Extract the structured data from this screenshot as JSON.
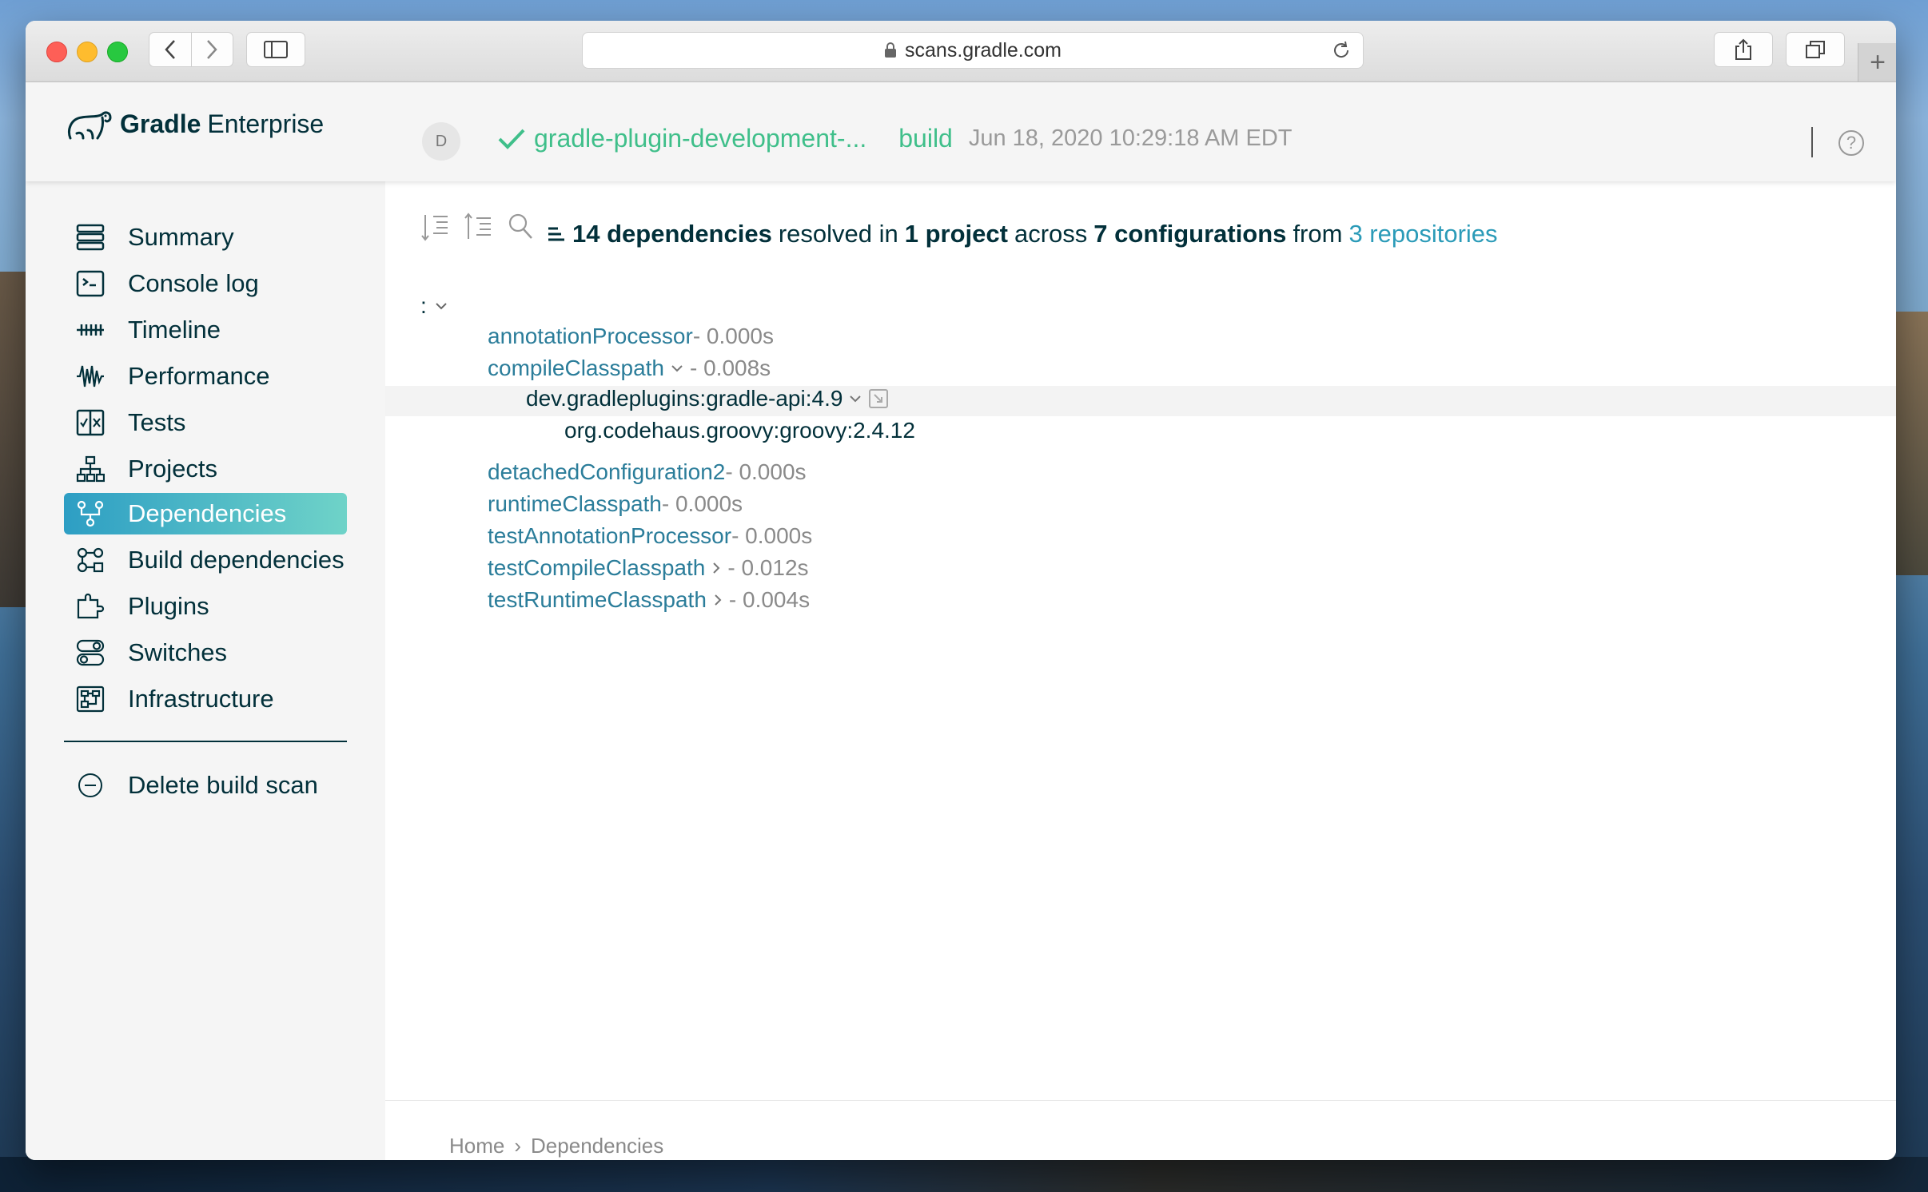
{
  "browser": {
    "url": "scans.gradle.com"
  },
  "app": {
    "logo_bold": "Gradle",
    "logo_light": "Enterprise",
    "avatar_initial": "D",
    "project": "gradle-plugin-development-...",
    "task": "build",
    "timestamp": "Jun 18, 2020 10:29:18 AM EDT",
    "status_color": "#3fbf8a"
  },
  "sidebar": {
    "items": [
      {
        "label": "Summary",
        "icon": "summary-icon"
      },
      {
        "label": "Console log",
        "icon": "console-icon"
      },
      {
        "label": "Timeline",
        "icon": "timeline-icon"
      },
      {
        "label": "Performance",
        "icon": "performance-icon"
      },
      {
        "label": "Tests",
        "icon": "tests-icon"
      },
      {
        "label": "Projects",
        "icon": "projects-icon"
      },
      {
        "label": "Dependencies",
        "icon": "dependencies-icon",
        "active": true
      },
      {
        "label": "Build dependencies",
        "icon": "build-dependencies-icon"
      },
      {
        "label": "Plugins",
        "icon": "plugins-icon"
      },
      {
        "label": "Switches",
        "icon": "switches-icon"
      },
      {
        "label": "Infrastructure",
        "icon": "infrastructure-icon"
      }
    ],
    "delete_label": "Delete build scan"
  },
  "summary": {
    "count": "14 dependencies",
    "resolved_in": "resolved in",
    "projects": "1 project",
    "across": "across",
    "configurations": "7 configurations",
    "from": "from",
    "repositories": "3 repositories"
  },
  "tree": {
    "root": ":",
    "configs": [
      {
        "name": "annotationProcessor",
        "duration": "- 0.000s"
      },
      {
        "name": "compileClasspath",
        "duration": "- 0.008s",
        "expanded": true
      },
      {
        "name": "detachedConfiguration2",
        "duration": "- 0.000s"
      },
      {
        "name": "runtimeClasspath",
        "duration": "- 0.000s"
      },
      {
        "name": "testAnnotationProcessor",
        "duration": "- 0.000s"
      },
      {
        "name": "testCompileClasspath",
        "duration": "- 0.012s",
        "collapsed": true
      },
      {
        "name": "testRuntimeClasspath",
        "duration": "- 0.004s",
        "collapsed": true
      }
    ],
    "dep1": "dev.gradleplugins:gradle-api:4.9",
    "dep2": "org.codehaus.groovy:groovy:2.4.12"
  },
  "breadcrumb": {
    "home": "Home",
    "separator": "›",
    "current": "Dependencies"
  }
}
